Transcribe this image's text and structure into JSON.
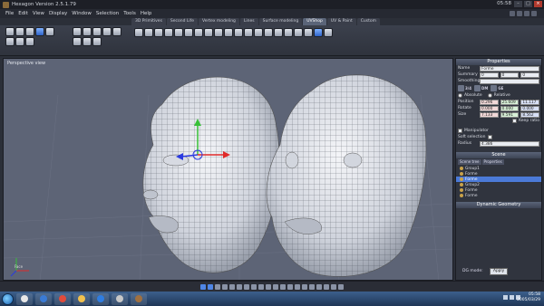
{
  "window": {
    "title": "Hexagon Version 2.5.1.79",
    "clock": "05:58"
  },
  "menu": [
    "File",
    "Edit",
    "View",
    "Display",
    "Window",
    "Selection",
    "Tools",
    "Help"
  ],
  "mode_tabs": [
    "3D Primitives",
    "Second Life",
    "Vertex modeling",
    "Lines",
    "Surface modeling",
    "UVShop",
    "UV & Paint",
    "Custom"
  ],
  "active_mode_tab": "UVShop",
  "viewport": {
    "label": "Perspective view",
    "axis_label": "Face"
  },
  "properties": {
    "header": "Properties",
    "name_label": "Name",
    "name_value": "Forme",
    "summary_label": "Summary",
    "summary_values": [
      "0",
      "0",
      "0"
    ],
    "smoothing_label": "Smoothing",
    "icons": [
      "3/4",
      "DM",
      "GE"
    ],
    "absolute_label": "Absolute",
    "relative_label": "Relative",
    "rows": [
      {
        "label": "Position",
        "x": "0.296",
        "y": "25.609",
        "z": "11.117"
      },
      {
        "label": "Rotate",
        "x": "0.000",
        "y": "0.000",
        "z": "0.000"
      },
      {
        "label": "Size",
        "x": "7.133",
        "y": "9.591",
        "z": "8.562"
      }
    ],
    "keep_ratio": "Keep ratio",
    "manipulator": "Manipulator",
    "soft_selection": "Soft selection",
    "radius_label": "Radius",
    "radius_value": "4.386"
  },
  "scene": {
    "header": "Scene",
    "tabs": [
      "Scene tree",
      "Properties"
    ],
    "rows": [
      "Group1",
      "Forme",
      "Forme",
      "Group2",
      "Forme",
      "Forme"
    ],
    "selected_index": 2
  },
  "dynamic_geometry": {
    "header": "Dynamic Geometry",
    "mode_label": "DG mode:",
    "mode_value": "Apply"
  },
  "taskbar": {
    "time": "05:58",
    "date": "2005/03/29"
  }
}
